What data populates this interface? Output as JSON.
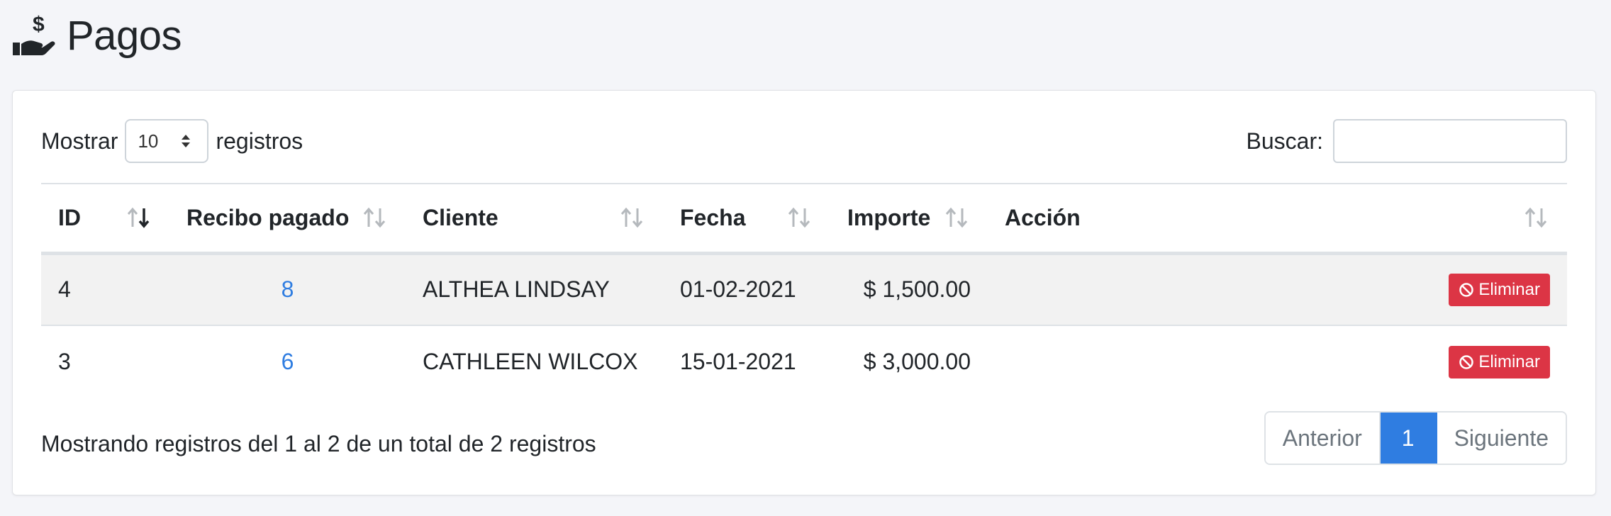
{
  "page": {
    "title": "Pagos",
    "icon": "hand-holding-dollar-icon"
  },
  "length": {
    "prefix": "Mostrar",
    "value": "10",
    "suffix": "registros"
  },
  "search": {
    "label": "Buscar:",
    "value": "",
    "placeholder": ""
  },
  "table": {
    "columns": [
      "ID",
      "Recibo pagado",
      "Cliente",
      "Fecha",
      "Importe",
      "Acción"
    ],
    "rows": [
      {
        "id": "4",
        "recibo": "8",
        "cliente": "ALTHEA LINDSAY",
        "fecha": "01-02-2021",
        "importe": "$ 1,500.00",
        "accion": "Eliminar"
      },
      {
        "id": "3",
        "recibo": "6",
        "cliente": "CATHLEEN WILCOX",
        "fecha": "15-01-2021",
        "importe": "$ 3,000.00",
        "accion": "Eliminar"
      }
    ]
  },
  "info": "Mostrando registros del 1 al 2 de un total de 2 registros",
  "pagination": {
    "previous": "Anterior",
    "current": "1",
    "next": "Siguiente"
  },
  "colors": {
    "accent": "#2f7de1",
    "danger": "#dc3545"
  }
}
